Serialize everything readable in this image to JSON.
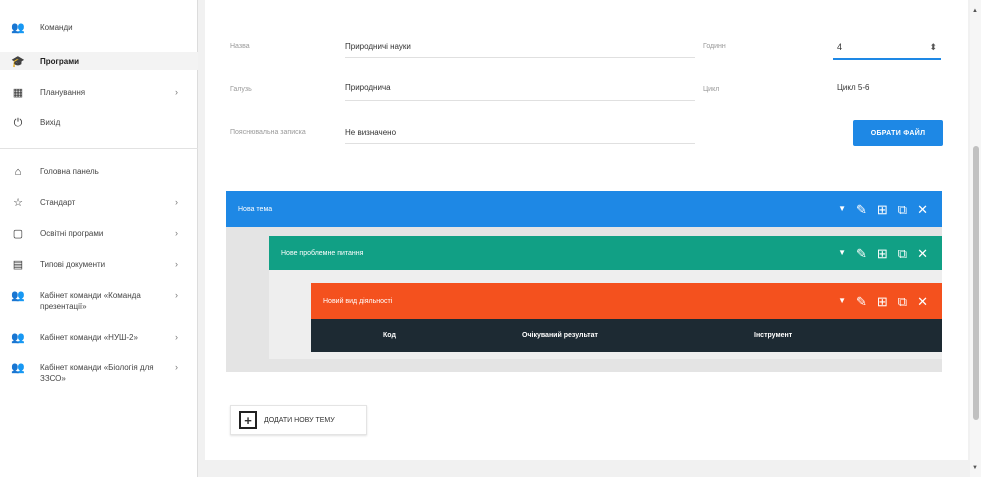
{
  "sidebar": {
    "items": [
      {
        "label": "Команди",
        "icon": "group-icon",
        "icon_char": "👥",
        "chevron": false
      },
      {
        "label": "Програми",
        "icon": "graduation-cap-icon",
        "icon_char": "🎓",
        "chevron": false
      },
      {
        "label": "Планування",
        "icon": "calendar-icon",
        "icon_char": "▦",
        "chevron": true
      },
      {
        "label": "Вихід",
        "icon": "power-icon",
        "icon_char": "⏻",
        "chevron": false
      },
      {
        "label": "Головна панель",
        "icon": "home-icon",
        "icon_char": "⌂",
        "chevron": false
      },
      {
        "label": "Стандарт",
        "icon": "star-icon",
        "icon_char": "☆",
        "chevron": true
      },
      {
        "label": "Освітні програми",
        "icon": "document-icon",
        "icon_char": "▢",
        "chevron": true
      },
      {
        "label": "Типові документи",
        "icon": "grid-icon",
        "icon_char": "▤",
        "chevron": true
      },
      {
        "label": "Кабінет команди «Команда презентації»",
        "icon": "group-icon",
        "icon_char": "👥",
        "chevron": true
      },
      {
        "label": "Кабінет команди «НУШ-2»",
        "icon": "group-icon",
        "icon_char": "👥",
        "chevron": true
      },
      {
        "label": "Кабінет команди «Біологія для ЗЗСО»",
        "icon": "group-icon",
        "icon_char": "👥",
        "chevron": true
      }
    ]
  },
  "form": {
    "name_label": "Назва",
    "name_value": "Природничі науки",
    "class_label": "Годинн",
    "class_value": "4",
    "branch_label": "Галузь",
    "branch_value": "Природнича",
    "cycle_label": "Цикл",
    "cycle_value": "Цикл 5-6",
    "note_label": "Пояснювальна записка",
    "note_value": "Не визначено",
    "file_button": "ОБРАТИ ФАЙЛ"
  },
  "blocks": {
    "topic_title": "Нова тема",
    "problem_title": "Нове проблемне питання",
    "activity_title": "Новий вид діяльності",
    "table_headers": [
      "Код",
      "Очікуваний результат",
      "Інструмент"
    ]
  },
  "actions": {
    "add_topic": "ДОДАТИ НОВУ ТЕМУ"
  },
  "colors": {
    "accent": "#1e88e5",
    "topic": "#1e88e5",
    "problem": "#11a085",
    "activity": "#f4511e",
    "table_header": "#1d2a33"
  }
}
